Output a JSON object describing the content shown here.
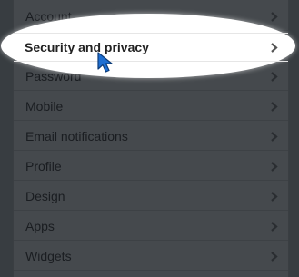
{
  "menu": {
    "items": [
      {
        "label": "Account"
      },
      {
        "label": "Security and privacy"
      },
      {
        "label": "Password"
      },
      {
        "label": "Mobile"
      },
      {
        "label": "Email notifications"
      },
      {
        "label": "Profile"
      },
      {
        "label": "Design"
      },
      {
        "label": "Apps"
      },
      {
        "label": "Widgets"
      }
    ],
    "active_index": 1,
    "chevron_icon": "chevron-right-icon"
  },
  "colors": {
    "page_bg": "#383d41",
    "menu_bg": "#45494d",
    "highlight_bg": "#ffffff",
    "cursor_fill": "#1e6fd2"
  }
}
